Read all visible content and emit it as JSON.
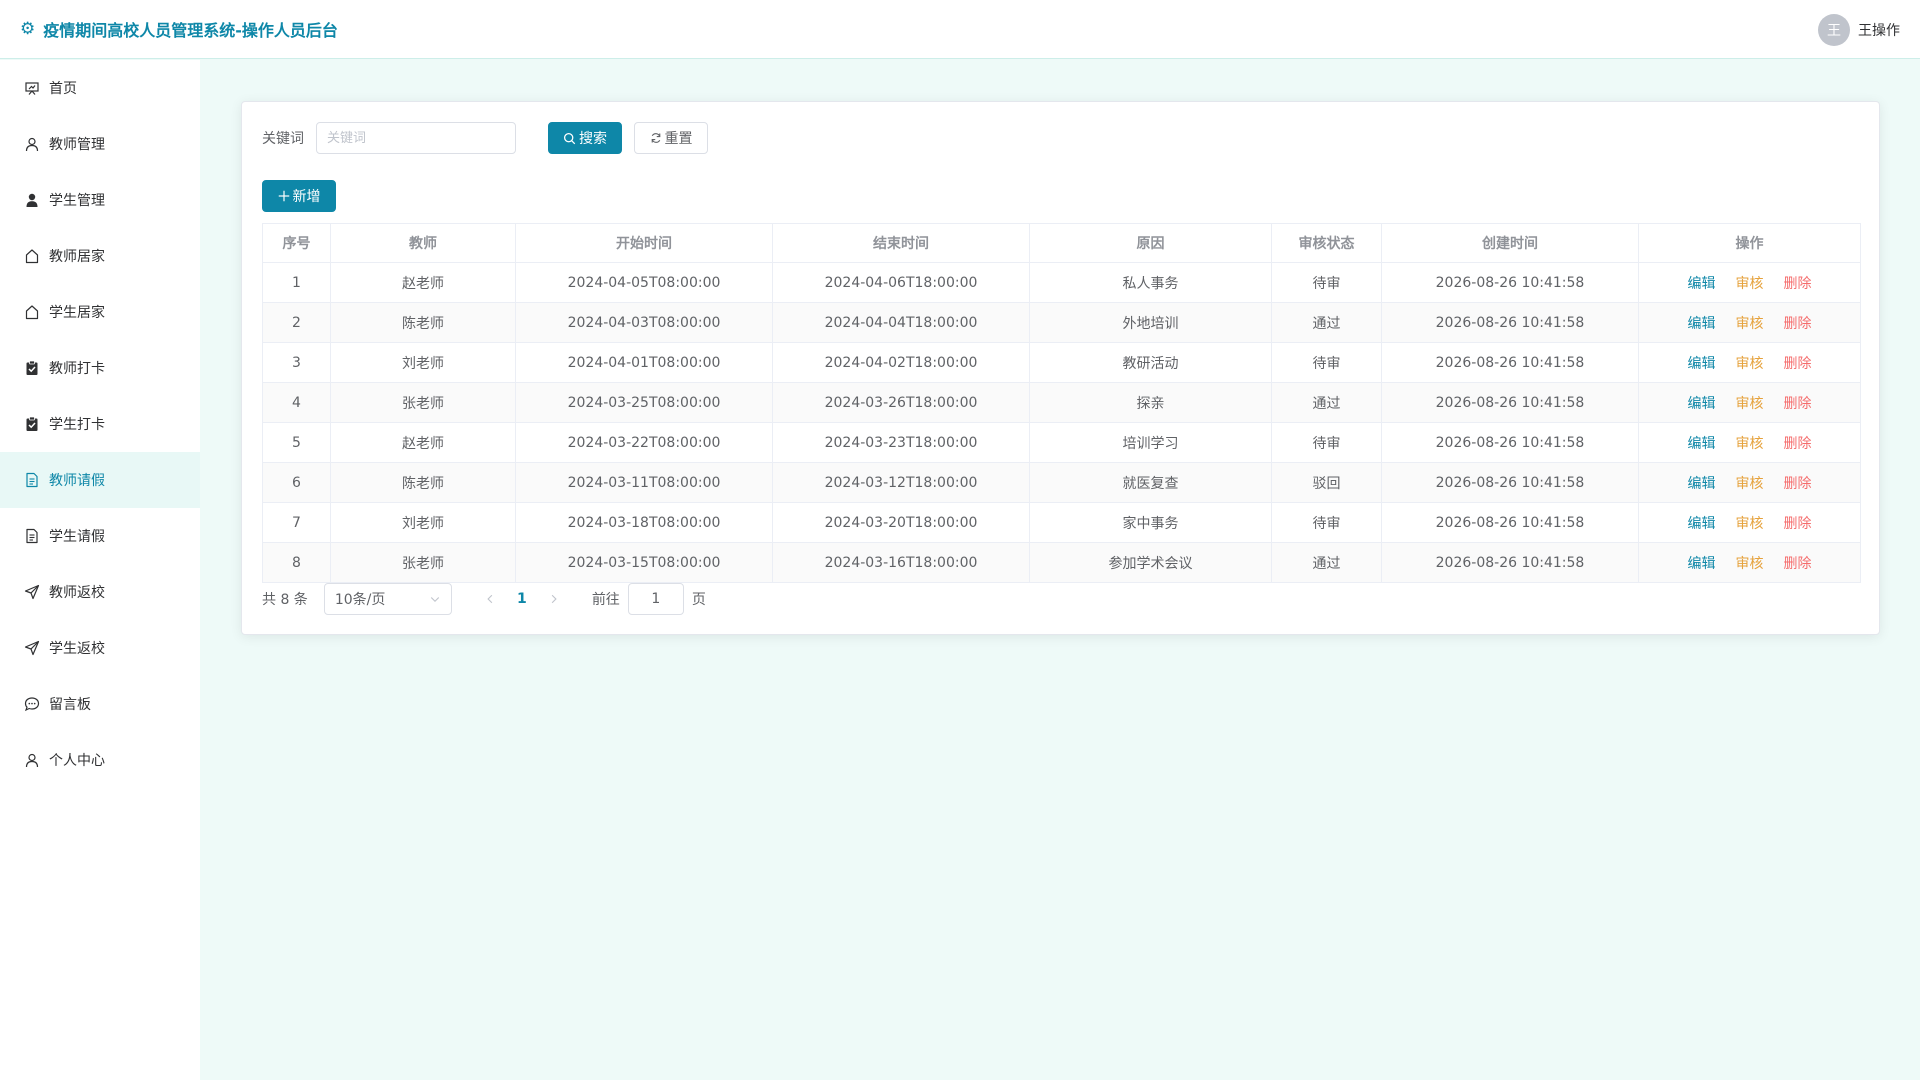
{
  "header": {
    "title": "疫情期间高校人员管理系统-操作人员后台",
    "avatar_text": "王",
    "username": "王操作"
  },
  "sidebar": {
    "items": [
      {
        "label": "首页",
        "icon": "home-board-icon"
      },
      {
        "label": "教师管理",
        "icon": "user-icon"
      },
      {
        "label": "学生管理",
        "icon": "user-filled-icon"
      },
      {
        "label": "教师居家",
        "icon": "house-icon"
      },
      {
        "label": "学生居家",
        "icon": "house-icon"
      },
      {
        "label": "教师打卡",
        "icon": "clipboard-check-icon"
      },
      {
        "label": "学生打卡",
        "icon": "clipboard-check-icon"
      },
      {
        "label": "教师请假",
        "icon": "document-icon",
        "active": true
      },
      {
        "label": "学生请假",
        "icon": "document-icon"
      },
      {
        "label": "教师返校",
        "icon": "send-icon"
      },
      {
        "label": "学生返校",
        "icon": "send-icon"
      },
      {
        "label": "留言板",
        "icon": "chat-icon"
      },
      {
        "label": "个人中心",
        "icon": "user-icon"
      }
    ]
  },
  "search": {
    "label": "关键词",
    "placeholder": "关键词",
    "value": "",
    "search_label": "搜索",
    "reset_label": "重置",
    "add_label": "新增"
  },
  "table": {
    "columns": [
      "序号",
      "教师",
      "开始时间",
      "结束时间",
      "原因",
      "审核状态",
      "创建时间",
      "操作"
    ],
    "rows": [
      [
        "1",
        "赵老师",
        "2024-04-05T08:00:00",
        "2024-04-06T18:00:00",
        "私人事务",
        "待审",
        "2026-08-26 10:41:58"
      ],
      [
        "2",
        "陈老师",
        "2024-04-03T08:00:00",
        "2024-04-04T18:00:00",
        "外地培训",
        "通过",
        "2026-08-26 10:41:58"
      ],
      [
        "3",
        "刘老师",
        "2024-04-01T08:00:00",
        "2024-04-02T18:00:00",
        "教研活动",
        "待审",
        "2026-08-26 10:41:58"
      ],
      [
        "4",
        "张老师",
        "2024-03-25T08:00:00",
        "2024-03-26T18:00:00",
        "探亲",
        "通过",
        "2026-08-26 10:41:58"
      ],
      [
        "5",
        "赵老师",
        "2024-03-22T08:00:00",
        "2024-03-23T18:00:00",
        "培训学习",
        "待审",
        "2026-08-26 10:41:58"
      ],
      [
        "6",
        "陈老师",
        "2024-03-11T08:00:00",
        "2024-03-12T18:00:00",
        "就医复查",
        "驳回",
        "2026-08-26 10:41:58"
      ],
      [
        "7",
        "刘老师",
        "2024-03-18T08:00:00",
        "2024-03-20T18:00:00",
        "家中事务",
        "待审",
        "2026-08-26 10:41:58"
      ],
      [
        "8",
        "张老师",
        "2024-03-15T08:00:00",
        "2024-03-16T18:00:00",
        "参加学术会议",
        "通过",
        "2026-08-26 10:41:58"
      ]
    ],
    "actions": {
      "edit": "编辑",
      "audit": "审核",
      "delete": "删除"
    }
  },
  "pagination": {
    "total_text": "共 8 条",
    "page_size": "10条/页",
    "current_page": "1",
    "goto_prefix": "前往",
    "goto_value": "1",
    "goto_suffix": "页"
  },
  "colors": {
    "primary": "#0e87a8",
    "audit": "#e6a23c",
    "delete": "#f56c6c",
    "background": "#eefaf8"
  }
}
